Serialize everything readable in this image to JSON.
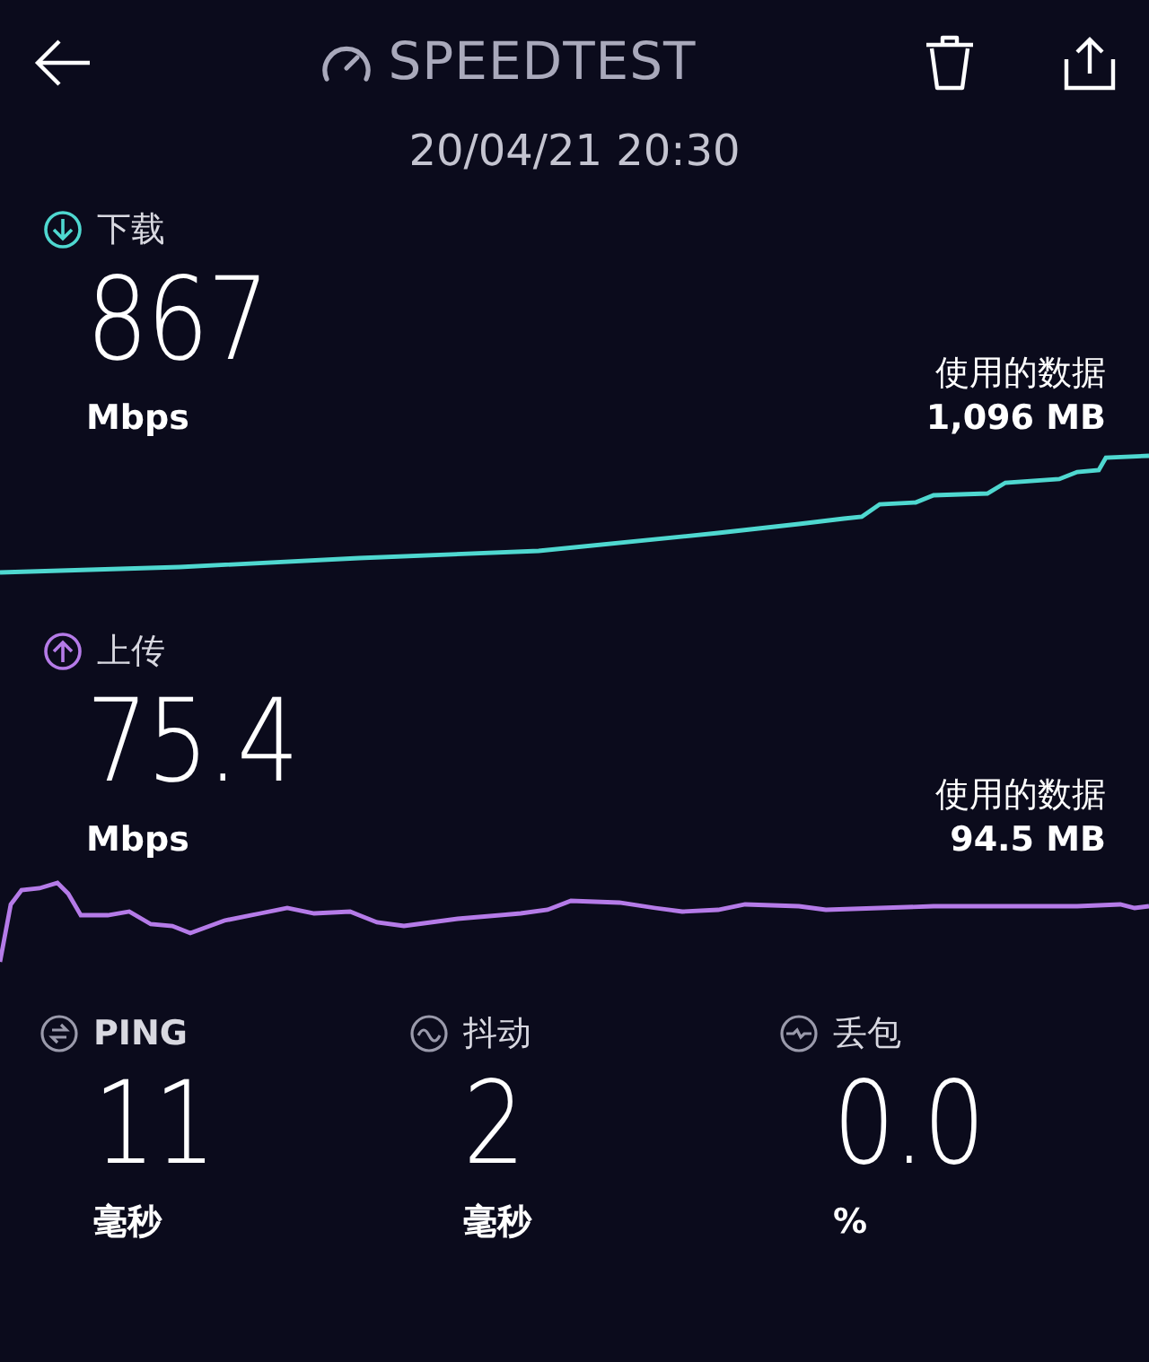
{
  "header": {
    "title": "SPEEDTEST",
    "date": "20/04/21 20:30"
  },
  "results": [
    {
      "kind": "download",
      "label": "下载",
      "value": "867",
      "unit": "Mbps",
      "data_label": "使用的数据",
      "data_value": "1,096 MB",
      "color": "#4fd8d0"
    },
    {
      "kind": "upload",
      "label": "上传",
      "value": "75.4",
      "unit": "Mbps",
      "data_label": "使用的数据",
      "data_value": "94.5 MB",
      "color": "#b57be8"
    }
  ],
  "metrics": [
    {
      "kind": "ping",
      "label": "PING",
      "value": "11",
      "unit": "毫秒"
    },
    {
      "kind": "jitter",
      "label": "抖动",
      "value": "2",
      "unit": "毫秒"
    },
    {
      "kind": "loss",
      "label": "丢包",
      "value": "0.0",
      "unit": "%"
    }
  ]
}
